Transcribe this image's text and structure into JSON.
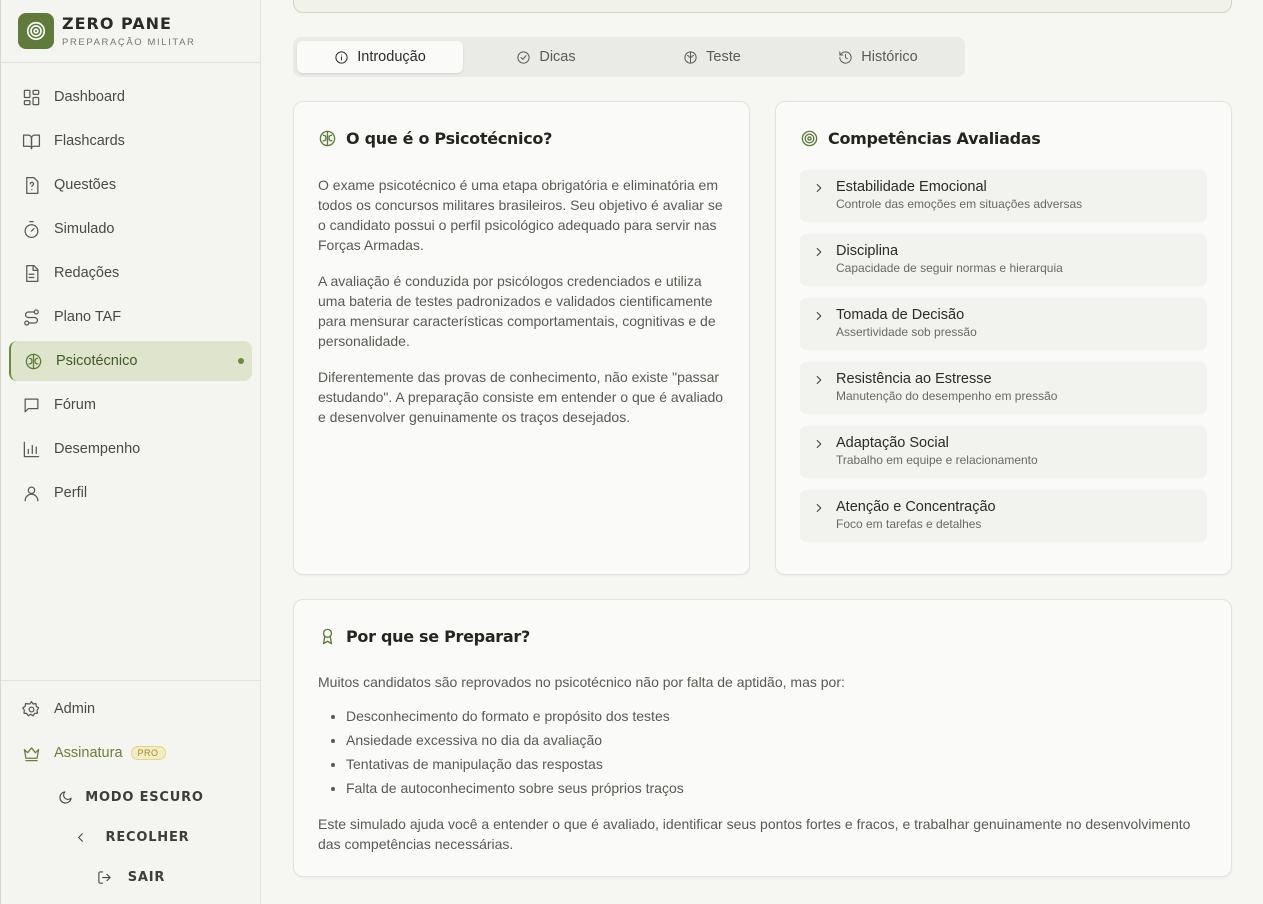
{
  "brand": {
    "name": "ZERO PANE",
    "subtitle": "PREPARAÇÃO MILITAR"
  },
  "sidebar": {
    "items": [
      {
        "label": "Dashboard",
        "icon": "dashboard-icon"
      },
      {
        "label": "Flashcards",
        "icon": "book-icon"
      },
      {
        "label": "Questões",
        "icon": "question-file-icon"
      },
      {
        "label": "Simulado",
        "icon": "timer-icon"
      },
      {
        "label": "Redações",
        "icon": "document-icon"
      },
      {
        "label": "Plano TAF",
        "icon": "route-icon"
      },
      {
        "label": "Psicotécnico",
        "icon": "brain-icon",
        "active": true
      },
      {
        "label": "Fórum",
        "icon": "chat-icon"
      },
      {
        "label": "Desempenho",
        "icon": "bar-chart-icon"
      },
      {
        "label": "Perfil",
        "icon": "user-icon"
      }
    ],
    "admin_label": "Admin",
    "subscription_label": "Assinatura",
    "subscription_badge": "PRO",
    "dark_mode_label": "MODO ESCURO",
    "collapse_label": "RECOLHER",
    "logout_label": "SAIR"
  },
  "tabs": [
    {
      "label": "Introdução",
      "icon": "info-icon",
      "active": true
    },
    {
      "label": "Dicas",
      "icon": "check-circle-icon"
    },
    {
      "label": "Teste",
      "icon": "brain-icon"
    },
    {
      "label": "Histórico",
      "icon": "history-icon"
    }
  ],
  "intro_card": {
    "title": "O que é o Psicotécnico?",
    "paragraphs": [
      "O exame psicotécnico é uma etapa obrigatória e eliminatória em todos os concursos militares brasileiros. Seu objetivo é avaliar se o candidato possui o perfil psicológico adequado para servir nas Forças Armadas.",
      "A avaliação é conduzida por psicólogos credenciados e utiliza uma bateria de testes padronizados e validados cientificamente para mensurar características comportamentais, cognitivas e de personalidade.",
      "Diferentemente das provas de conhecimento, não existe \"passar estudando\". A preparação consiste em entender o que é avaliado e desenvolver genuinamente os traços desejados."
    ]
  },
  "competencies_card": {
    "title": "Competências Avaliadas",
    "items": [
      {
        "title": "Estabilidade Emocional",
        "desc": "Controle das emoções em situações adversas"
      },
      {
        "title": "Disciplina",
        "desc": "Capacidade de seguir normas e hierarquia"
      },
      {
        "title": "Tomada de Decisão",
        "desc": "Assertividade sob pressão"
      },
      {
        "title": "Resistência ao Estresse",
        "desc": "Manutenção do desempenho em pressão"
      },
      {
        "title": "Adaptação Social",
        "desc": "Trabalho em equipe e relacionamento"
      },
      {
        "title": "Atenção e Concentração",
        "desc": "Foco em tarefas e detalhes"
      }
    ]
  },
  "prepare_card": {
    "title": "Por que se Preparar?",
    "intro": "Muitos candidatos são reprovados no psicotécnico não por falta de aptidão, mas por:",
    "bullets": [
      "Desconhecimento do formato e propósito dos testes",
      "Ansiedade excessiva no dia da avaliação",
      "Tentativas de manipulação das respostas",
      "Falta de autoconhecimento sobre seus próprios traços"
    ],
    "outro": "Este simulado ajuda você a entender o que é avaliado, identificar seus pontos fortes e fracos, e trabalhar genuinamente no desenvolvimento das competências necessárias."
  },
  "colors": {
    "accent": "#5f7a3a",
    "active_bg": "#dfe5cd",
    "background": "#f6f6f3"
  }
}
